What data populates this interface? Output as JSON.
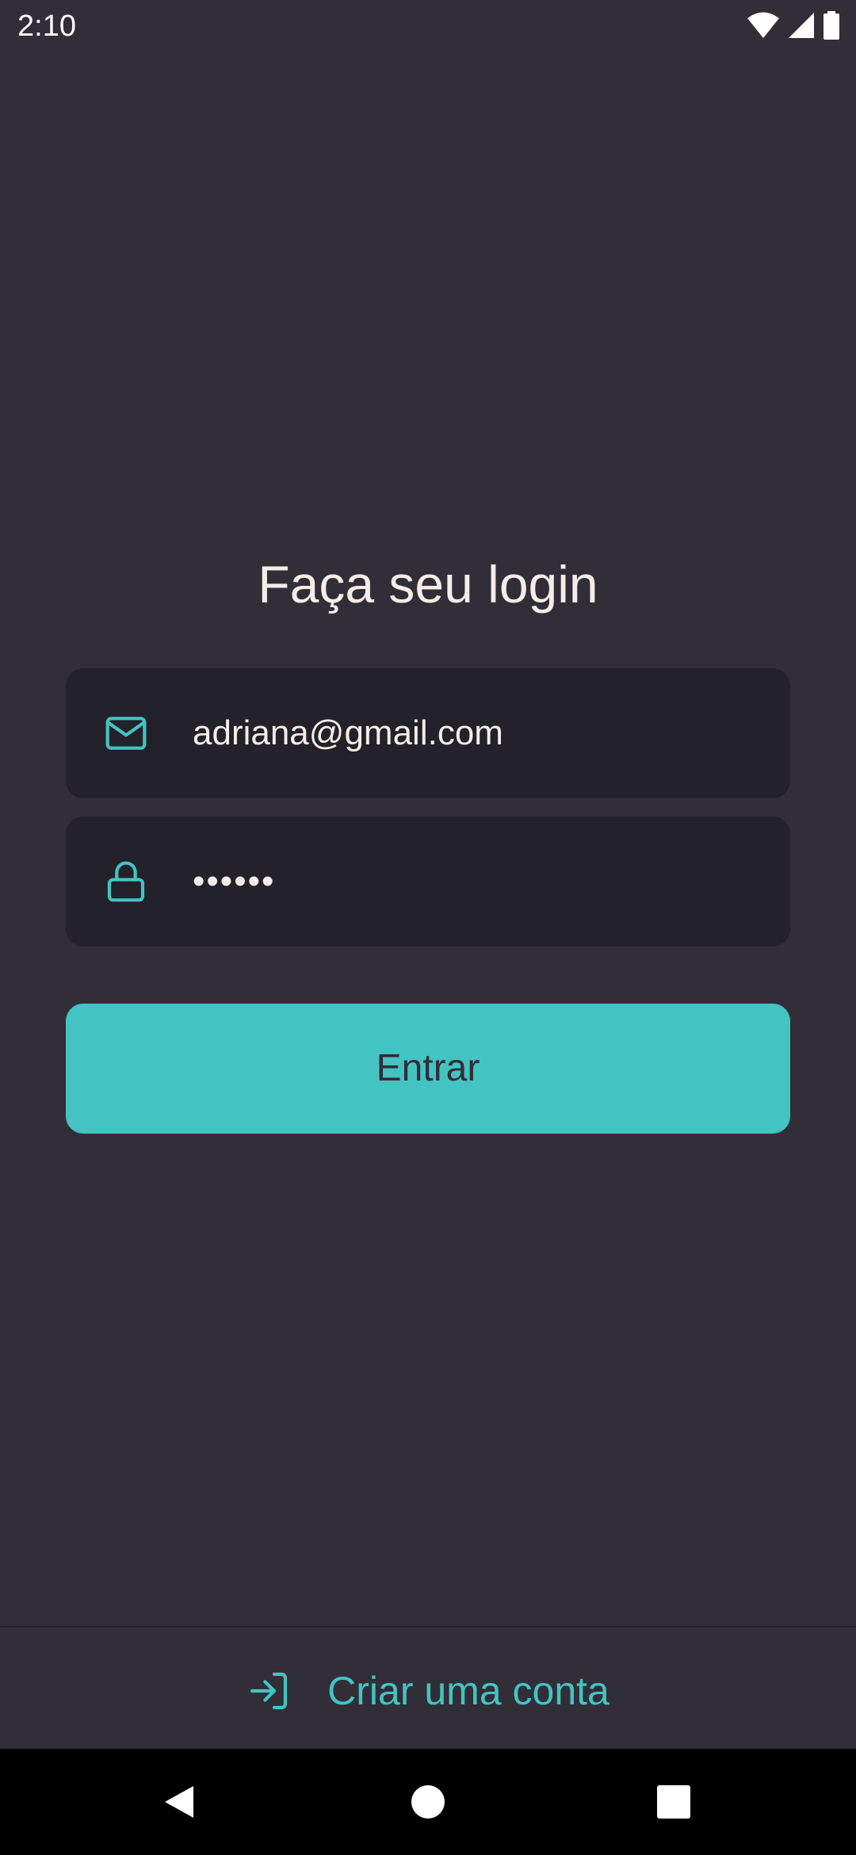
{
  "status_bar": {
    "time": "2:10",
    "icons": [
      "wifi-icon",
      "signal-icon",
      "battery-icon"
    ]
  },
  "login": {
    "title": "Faça seu login",
    "email": {
      "value": "adriana@gmail.com",
      "icon": "mail-icon"
    },
    "password": {
      "value": "••••••",
      "icon": "lock-icon"
    },
    "submit_label": "Entrar"
  },
  "footer": {
    "create_account_label": "Criar uma conta",
    "icon": "log-in-icon"
  },
  "nav": {
    "buttons": [
      "back",
      "home",
      "recents"
    ]
  },
  "colors": {
    "background": "#312e38",
    "input_background": "#232129",
    "accent": "#44c3c3",
    "text": "#f4ede8"
  }
}
